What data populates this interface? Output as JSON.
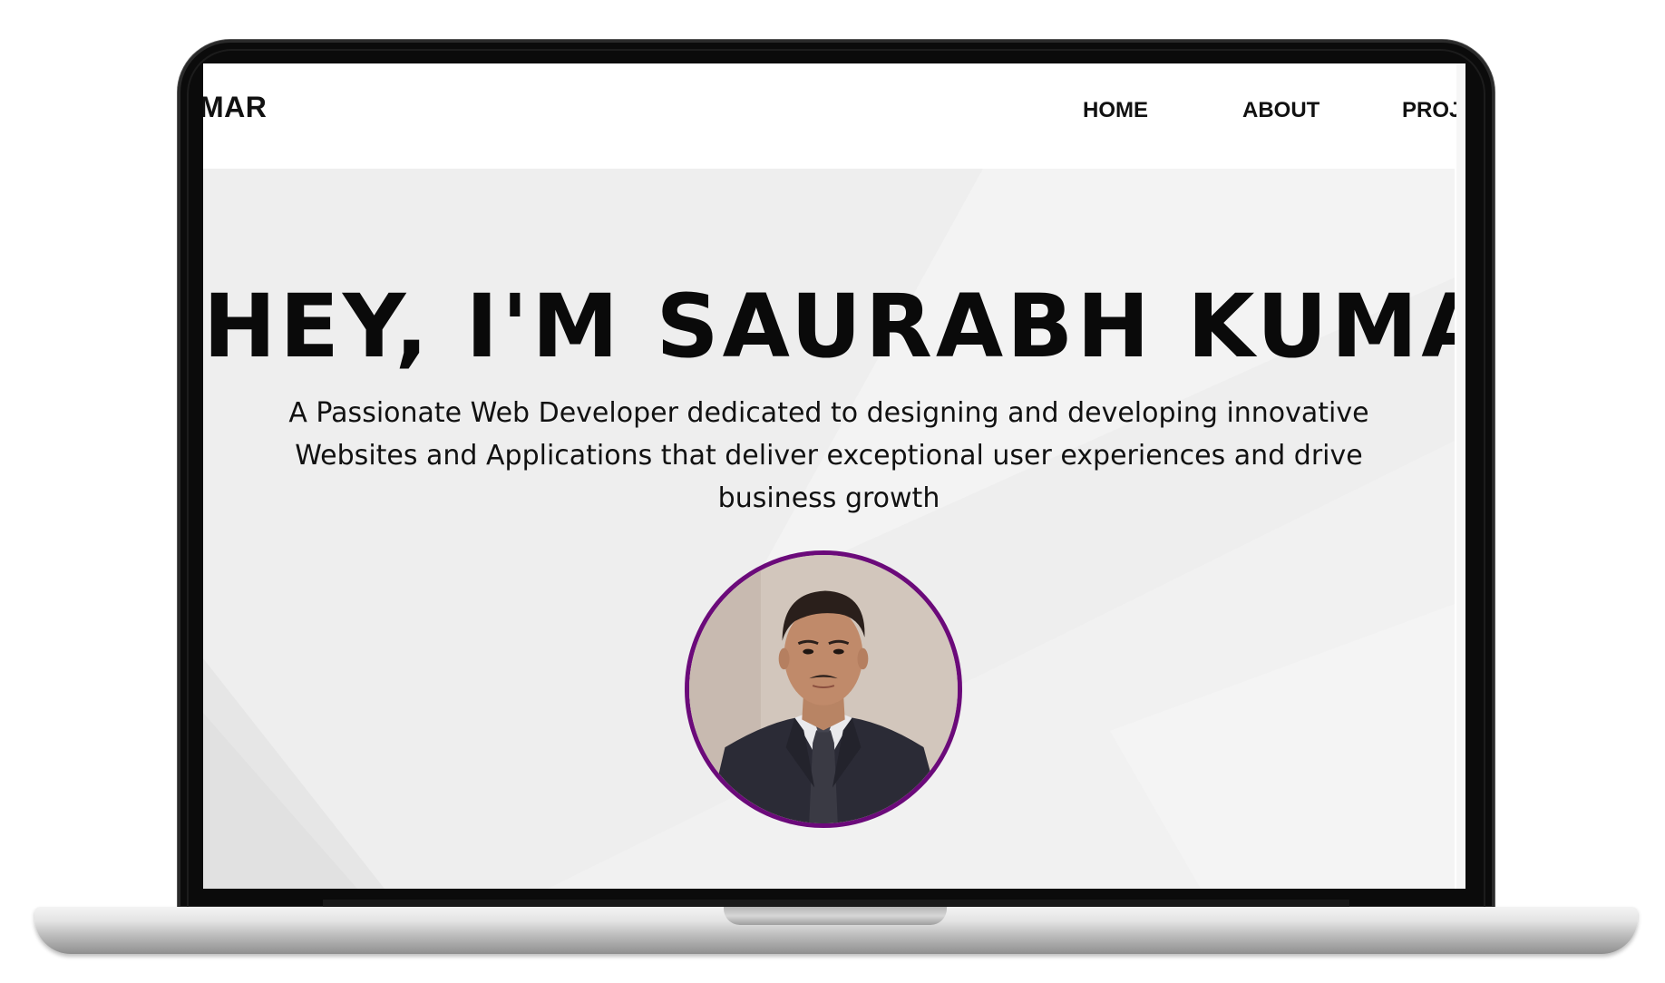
{
  "navbar": {
    "brand": "MAR",
    "links": [
      {
        "label": "HOME"
      },
      {
        "label": "ABOUT"
      },
      {
        "label": "PROJ"
      }
    ]
  },
  "hero": {
    "title": "HEY, I'M SAURABH KUMAR",
    "subtitle_lines": [
      "A Passionate Web Developer dedicated to designing and developing innovative",
      "Websites and Applications that deliver exceptional user experiences and drive",
      "business growth"
    ],
    "avatar_icon": "profile-photo",
    "avatar_border_color": "#6b0a7a"
  },
  "colors": {
    "hero_background": "#efefef",
    "text": "#0a0a0a",
    "device_frame": "#0b0b0b"
  }
}
